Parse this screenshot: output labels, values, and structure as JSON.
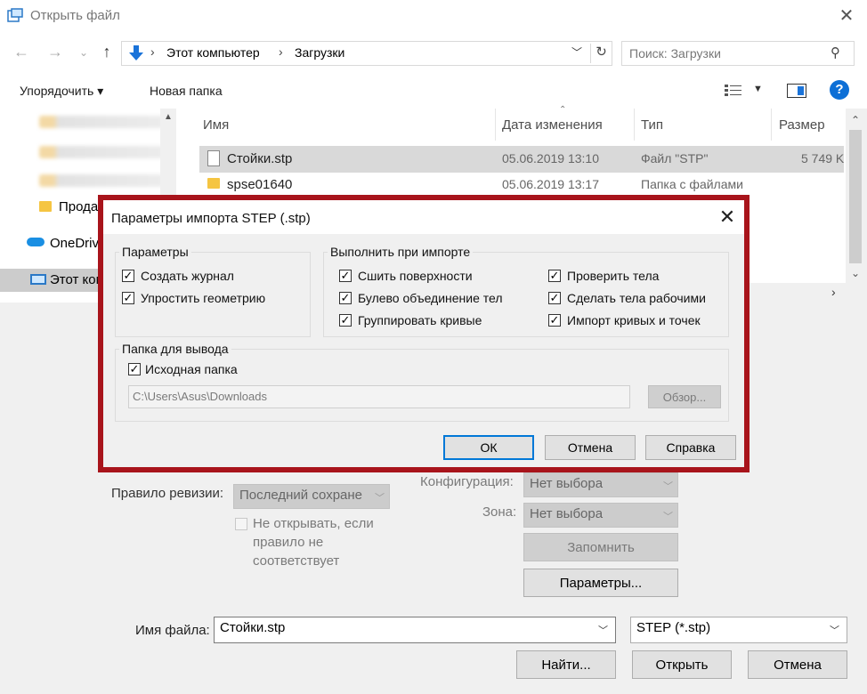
{
  "window": {
    "title": "Открыть файл",
    "close_glyph": "✕"
  },
  "address": {
    "breadcrumbs": [
      "Этот компьютер",
      "Загрузки"
    ],
    "search_placeholder": "Поиск: Загрузки"
  },
  "toolbar": {
    "organize_label": "Упорядочить ▾",
    "new_folder_label": "Новая папка"
  },
  "nav": {
    "items": [
      {
        "label": "Прода"
      },
      {
        "label": "OneDriv"
      },
      {
        "label": "Этот ком"
      }
    ]
  },
  "files": {
    "columns": [
      "Имя",
      "Дата изменения",
      "Тип",
      "Размер"
    ],
    "rows": [
      {
        "name": "Стойки.stp",
        "date": "05.06.2019 13:10",
        "type": "Файл \"STP\"",
        "size": "5 749 K"
      },
      {
        "name": "spse01640",
        "date": "05.06.2019 13:17",
        "type": "Папка с файлами",
        "size": ""
      }
    ]
  },
  "form": {
    "revision_rule_label": "Правило ревизии:",
    "revision_rule_value": "Последний сохране",
    "dont_open_label": [
      "Не открывать, если",
      "правило не",
      "соответствует"
    ],
    "configuration_label": "Конфигурация:",
    "configuration_value": "Нет выбора",
    "zone_label": "Зона:",
    "zone_value": "Нет выбора",
    "remember_label": "Запомнить",
    "params_label": "Параметры...",
    "filename_label": "Имя файла:",
    "filename_value": "Стойки.stp",
    "filetype_value": "STEP (*.stp)",
    "find_label": "Найти...",
    "open_label": "Открыть",
    "cancel_label": "Отмена"
  },
  "dialog": {
    "title": "Параметры импорта STEP (.stp)",
    "params_group": {
      "title": "Параметры",
      "options": [
        {
          "label": "Создать журнал",
          "checked": true
        },
        {
          "label": "Упростить геометрию",
          "checked": true
        }
      ]
    },
    "on_import_group": {
      "title": "Выполнить при импорте",
      "left": [
        {
          "label": "Сшить поверхности",
          "checked": true
        },
        {
          "label": "Булево объединение тел",
          "checked": true
        },
        {
          "label": "Группировать кривые",
          "checked": true
        }
      ],
      "right": [
        {
          "label": "Проверить тела",
          "checked": true
        },
        {
          "label": "Сделать тела рабочими",
          "checked": true
        },
        {
          "label": "Импорт кривых и точек",
          "checked": true
        }
      ]
    },
    "output_group": {
      "title": "Папка для вывода",
      "source_folder_label": "Исходная папка",
      "source_folder_checked": true,
      "path": "C:\\Users\\Asus\\Downloads",
      "browse_label": "Обзор..."
    },
    "ok_label": "ОК",
    "cancel_label": "Отмена",
    "help_label": "Справка"
  },
  "colors": {
    "accent": "#0078d7",
    "highlight_frame": "#a8141b",
    "help_blue": "#0d6fd6"
  }
}
